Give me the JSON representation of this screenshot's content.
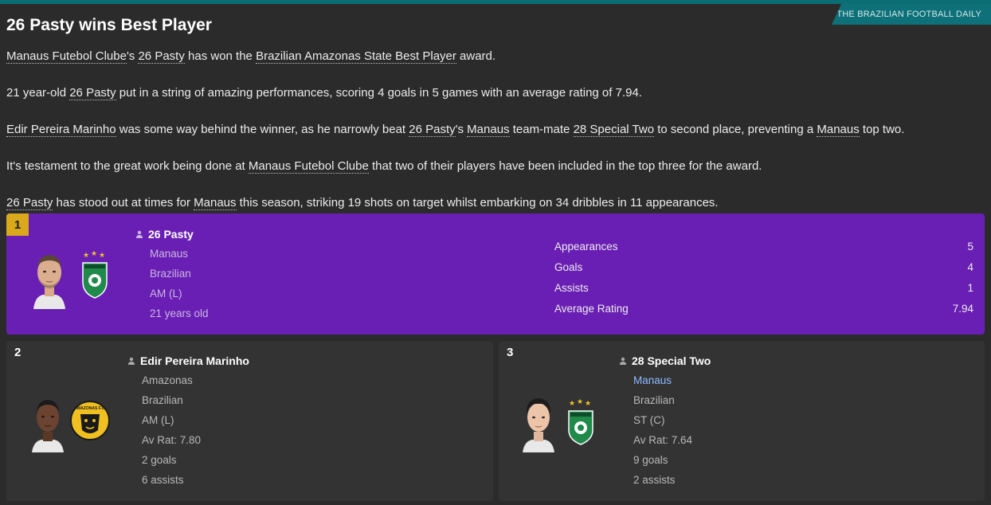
{
  "source": "THE BRAZILIAN FOOTBALL DAILY",
  "headline": "26 Pasty wins Best Player",
  "p1": {
    "club": "Manaus Futebol Clube",
    "s1": "'s ",
    "player": "26 Pasty",
    "s2": " has won the ",
    "award": "Brazilian Amazonas State Best Player",
    "s3": " award."
  },
  "p2": {
    "s1": "21 year-old ",
    "player": "26 Pasty",
    "s2": " put in a string of amazing performances, scoring 4 goals in 5 games with an average rating of 7.94."
  },
  "p3": {
    "p1": "Edir Pereira Marinho",
    "s1": " was some way behind the winner, as he narrowly beat ",
    "p2": "26 Pasty",
    "s2": "'s ",
    "c1": "Manaus",
    "s3": " team-mate ",
    "p3": "28 Special Two",
    "s4": " to second place, preventing a ",
    "c2": "Manaus",
    "s5": " top two."
  },
  "p4": {
    "s1": "It's testament to the great work being done at ",
    "club": "Manaus Futebol Clube",
    "s2": " that two of their players have been included in the top three for the award."
  },
  "p5": {
    "player": "26 Pasty",
    "s1": " has stood out at times for ",
    "club": "Manaus",
    "s2": " this season, striking 19 shots on target whilst embarking on 34 dribbles in 11 appearances."
  },
  "winner": {
    "rank": "1",
    "name": "26 Pasty",
    "club": "Manaus",
    "nationality": "Brazilian",
    "position": "AM (L)",
    "age": "21 years old",
    "stats": [
      {
        "label": "Appearances",
        "value": "5"
      },
      {
        "label": "Goals",
        "value": "4"
      },
      {
        "label": "Assists",
        "value": "1"
      },
      {
        "label": "Average Rating",
        "value": "7.94"
      }
    ]
  },
  "second": {
    "rank": "2",
    "name": "Edir Pereira Marinho",
    "club": "Amazonas",
    "nationality": "Brazilian",
    "position": "AM (L)",
    "rating": "Av Rat: 7.80",
    "goals": "2 goals",
    "assists": "6 assists",
    "crest_text": "AMAZONAS F.C."
  },
  "third": {
    "rank": "3",
    "name": "28 Special Two",
    "club": "Manaus",
    "nationality": "Brazilian",
    "position": "ST (C)",
    "rating": "Av Rat: 7.64",
    "goals": "9 goals",
    "assists": "2 assists"
  },
  "colors": {
    "accent": "#0e7078",
    "winner_bg": "#6a1fb4",
    "rank_gold": "#d9a81b",
    "card_bg": "#333333",
    "page_bg": "#2b2b2b",
    "club_link": "#8db9ff"
  },
  "icons": {
    "person": "person-icon",
    "manaus_crest": "manaus-crest-icon",
    "amazonas_crest": "amazonas-crest-icon"
  }
}
